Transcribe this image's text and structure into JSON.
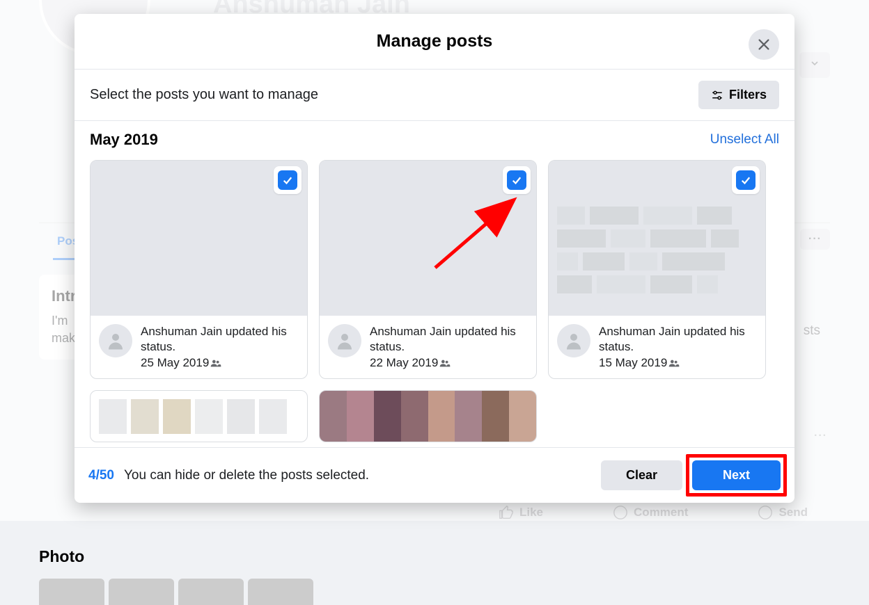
{
  "background": {
    "profile_name": "Anshuman Jain",
    "tabs": {
      "posts": "Posts"
    },
    "intro": {
      "heading": "Intro",
      "line1": "I'm",
      "line2": "mak"
    },
    "photos_heading": "Photo",
    "posts_label": "sts",
    "actions": {
      "like": "Like",
      "comment": "Comment",
      "send": "Send"
    },
    "menu_dots": "···"
  },
  "modal": {
    "title": "Manage posts",
    "subheader": "Select the posts you want to manage",
    "filters_label": "Filters",
    "month": "May 2019",
    "unselect_label": "Unselect All",
    "posts": [
      {
        "text": "Anshuman Jain updated his status.",
        "date": "25 May 2019"
      },
      {
        "text": "Anshuman Jain updated his status.",
        "date": "22 May 2019"
      },
      {
        "text": "Anshuman Jain updated his status.",
        "date": "15 May 2019"
      }
    ],
    "footer": {
      "count": "4/50",
      "text": "You can hide or delete the posts selected.",
      "clear": "Clear",
      "next": "Next"
    }
  }
}
